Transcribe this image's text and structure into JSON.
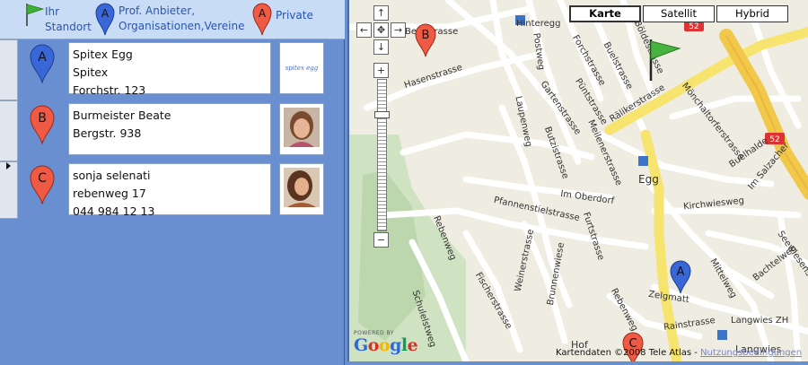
{
  "legend": {
    "standort_label": "Ihr\nStandort",
    "prof_label": "Prof. Anbieter,\nOrganisationen,Vereine",
    "private_label": "Private"
  },
  "entries": [
    {
      "marker": "A",
      "marker_color": "#3a67d8",
      "lines": [
        "Spitex Egg",
        "Spitex",
        "Forchstr. 123"
      ],
      "photo": "spitex"
    },
    {
      "marker": "B",
      "marker_color": "#ee5a44",
      "lines": [
        "Burmeister Beate",
        "Bergstr. 938",
        ""
      ],
      "photo": "person"
    },
    {
      "marker": "C",
      "marker_color": "#ee5a44",
      "lines": [
        "sonja selenati",
        "rebenweg 17",
        "044 984 12 13"
      ],
      "photo": "person"
    }
  ],
  "map": {
    "types": {
      "map": "Karte",
      "satellite": "Satellit",
      "hybrid": "Hybrid"
    },
    "streets": [
      "Hinteregg",
      "Bergstrasse",
      "Forchstrasse",
      "Buelstrasse",
      "Rälikerstrasse",
      "Hasenstrasse",
      "Gartenstrasse",
      "Püntstrasse",
      "Laupenweg",
      "Mönchaltorferstrasse",
      "Buelhalde",
      "Im Salzacher",
      "Butzistrasse",
      "Meilenerstrasse",
      "Egg",
      "Kirchwiesweg",
      "Im Oberdorf",
      "Pfannenstielstrasse",
      "Furtstrasse",
      "Brunnenwiese",
      "Weinerstrasse",
      "Fischerstrasse",
      "Schulelstweg",
      "Bachtelweg",
      "Seewiesenstrasse",
      "Mittelweg",
      "Zelgmatt",
      "Rainstrasse",
      "Langwies ZH",
      "Langwies",
      "Hof",
      "Rebenweg",
      "Postweg",
      "Im Böldestrasse",
      "Rebenweg"
    ],
    "road_numbers": [
      "52",
      "52"
    ],
    "copyright_text": "Kartendaten ©2008 Tele Atlas - ",
    "terms_link": "Nutzungsbedingungen",
    "powered_by": "POWERED BY",
    "google": "Google"
  }
}
